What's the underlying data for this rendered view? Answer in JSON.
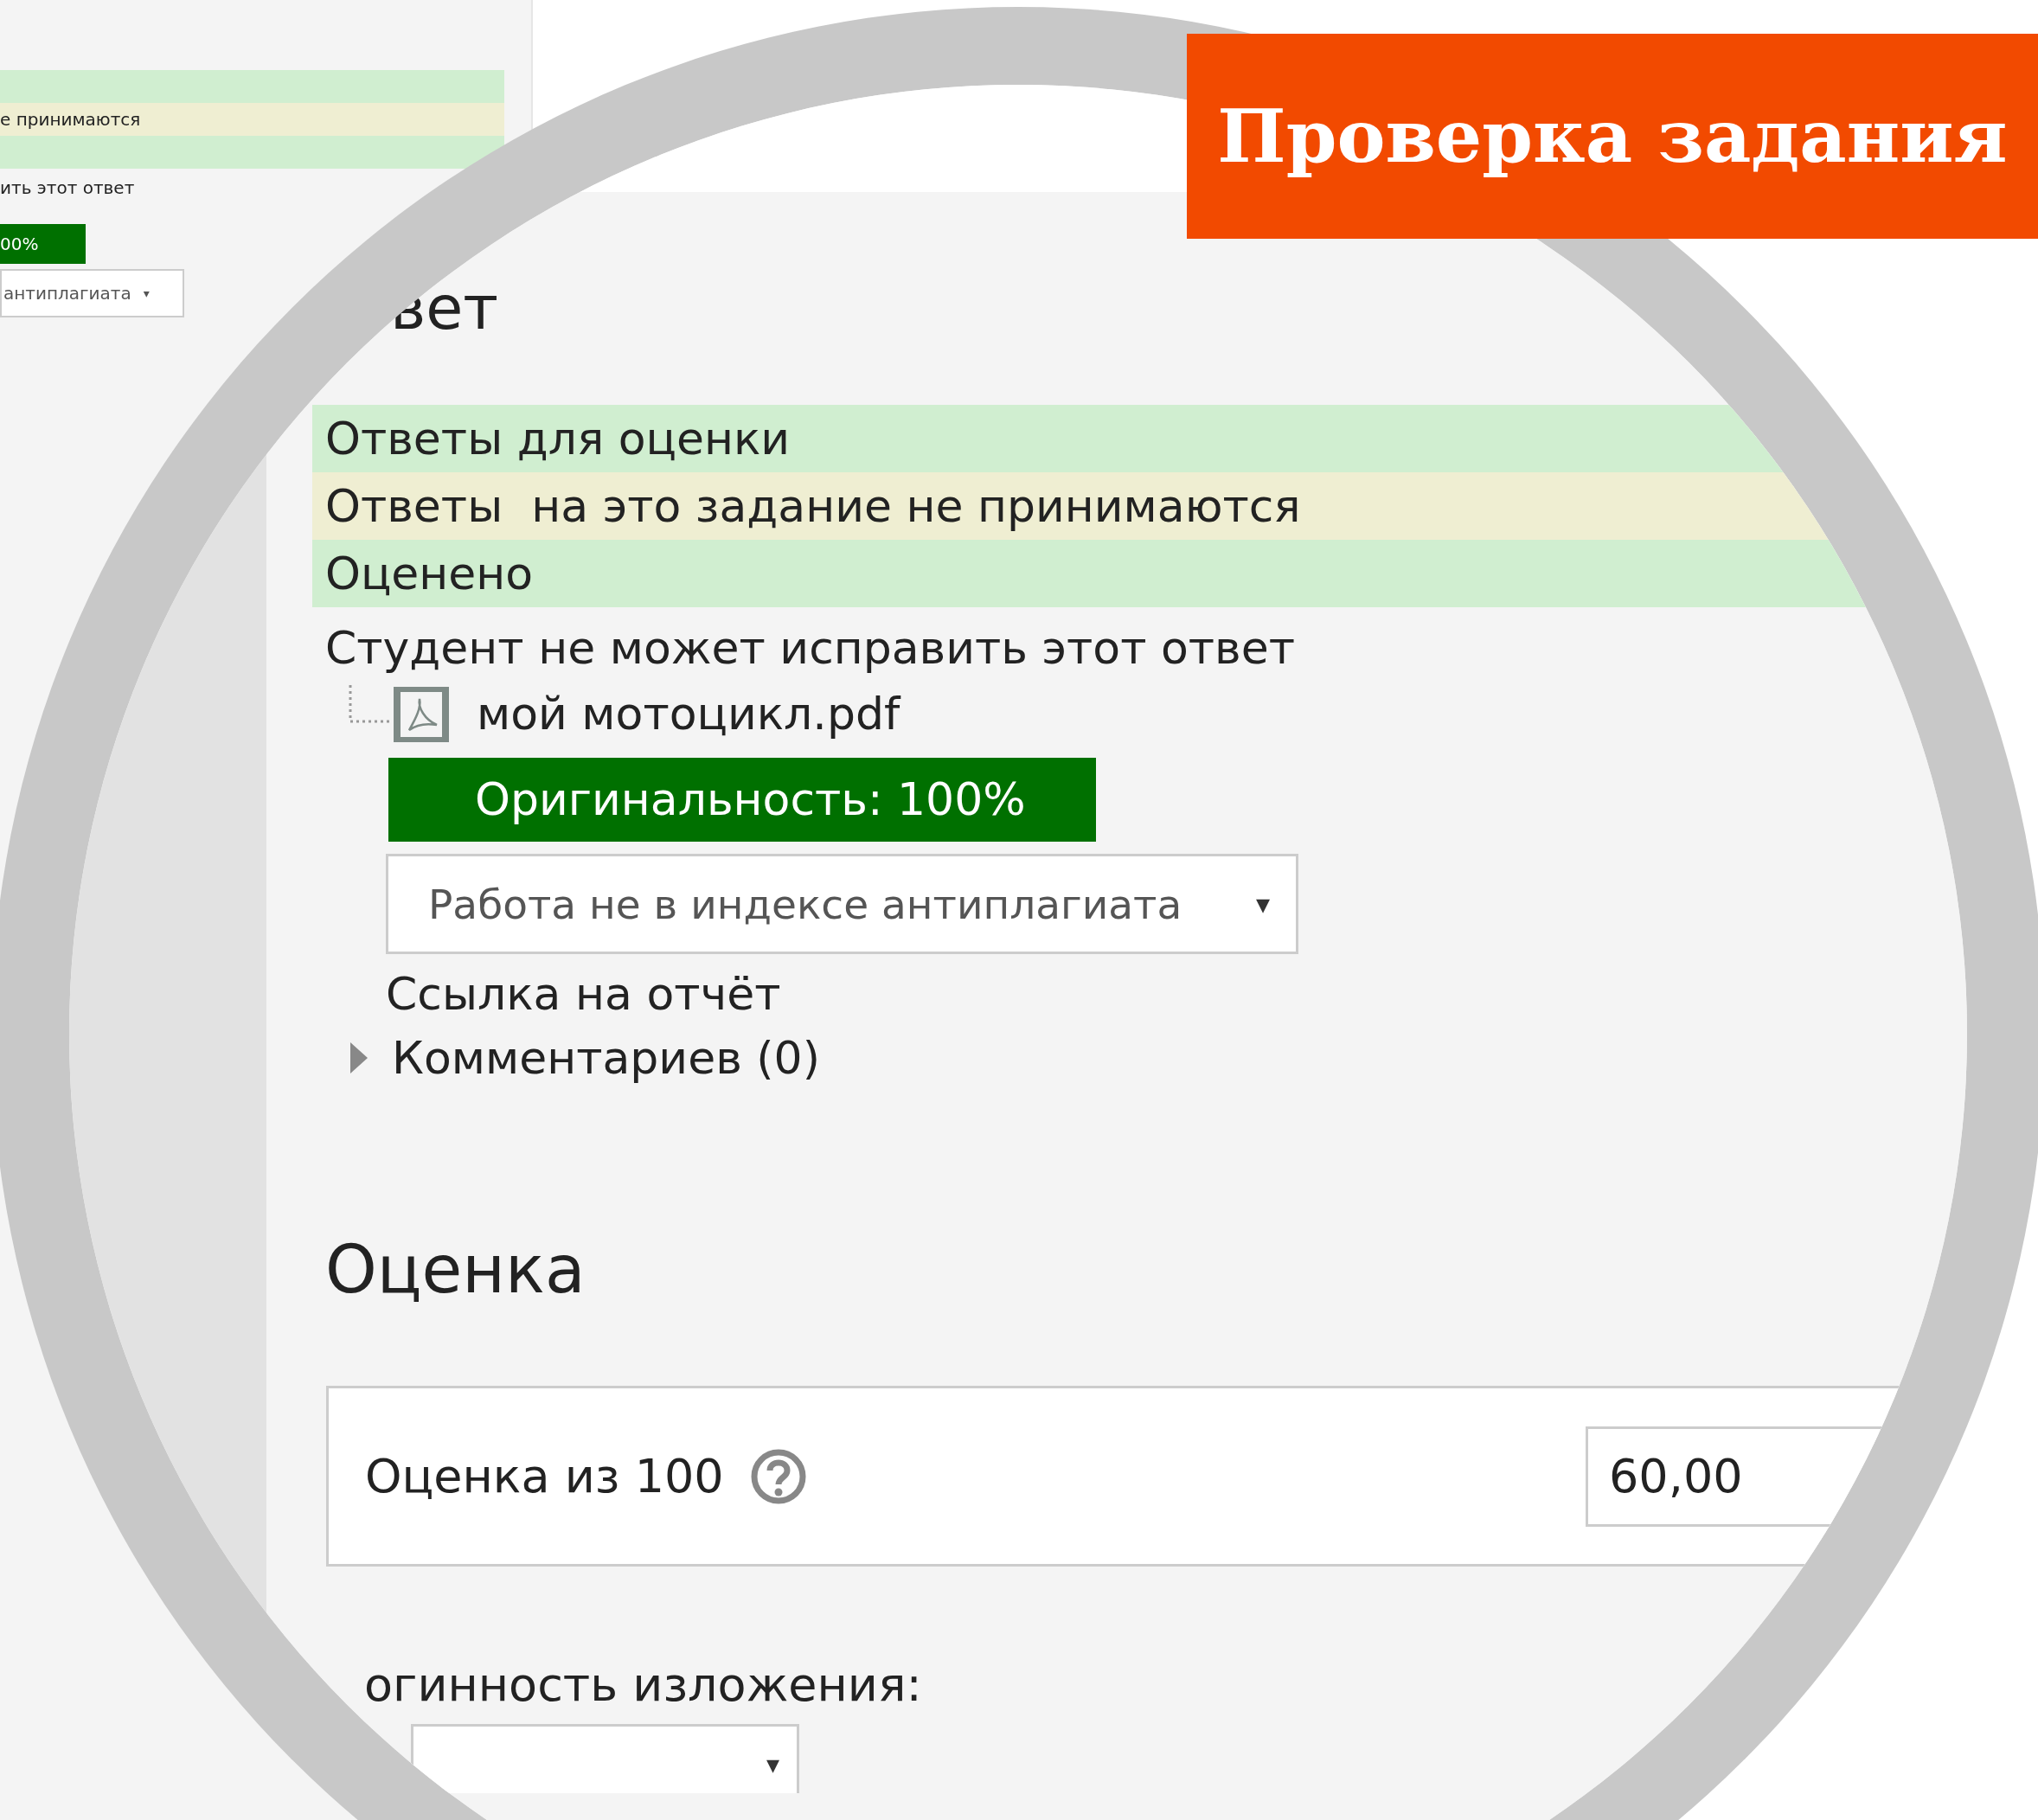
{
  "background_page": {
    "rows": [
      {
        "kind": "ok"
      },
      {
        "kind": "warning",
        "text": "е принимаются"
      },
      {
        "kind": "ok"
      }
    ],
    "status_text": "ить этот ответ",
    "originality": "00%",
    "index_select": {
      "value": "антиплагиата",
      "caret": "▾"
    }
  },
  "banner": {
    "title": "Проверка задания"
  },
  "magnified": {
    "section_title": "вет",
    "status_rows": [
      {
        "label": "Ответы для оценки",
        "kind": "ok"
      },
      {
        "label": "Ответы  на это задание не принимаются",
        "kind": "warning"
      },
      {
        "label": "Оценено",
        "kind": "ok"
      }
    ],
    "note": "Студент не может исправить этот ответ",
    "file": {
      "name": "мой мотоцикл.pdf"
    },
    "originality": "Оригинальность: 100%",
    "index_select": {
      "value": "Работа не в индексе антиплагиата",
      "caret": "▾"
    },
    "report_link": "Ссылка на отчёт",
    "comments": {
      "label": "Комментариев (0)",
      "expanded": false
    },
    "grade_title": "Оценка",
    "grade": {
      "label": "Оценка из 100",
      "value": "60,00"
    },
    "criterion": {
      "label": "огинность изложения:",
      "caret": "▾"
    }
  }
}
